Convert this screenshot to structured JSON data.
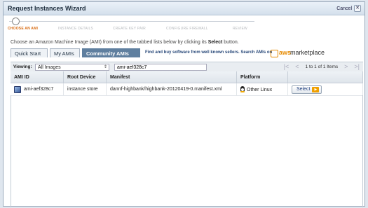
{
  "dialog": {
    "title": "Request Instances Wizard",
    "cancel_label": "Cancel"
  },
  "steps": [
    {
      "label": "CHOOSE AN AMI",
      "active": true
    },
    {
      "label": "INSTANCE DETAILS",
      "active": false
    },
    {
      "label": "CREATE KEY PAIR",
      "active": false
    },
    {
      "label": "CONFIGURE FIREWALL",
      "active": false
    },
    {
      "label": "REVIEW",
      "active": false
    }
  ],
  "intro": {
    "before": "Choose an Amazon Machine Image (AMI) from one of the tabbed lists below by clicking its ",
    "bold": "Select",
    "after": " button."
  },
  "tabs": [
    {
      "label": "Quick Start",
      "active": false
    },
    {
      "label": "My AMIs",
      "active": false
    },
    {
      "label": "Community AMIs",
      "active": true
    }
  ],
  "marketplace": {
    "note": "Find and buy software from well known sellers. Search AMIs on",
    "logo_aws": "aws",
    "logo_rest": "marketplace"
  },
  "filter": {
    "viewing_label": "Viewing:",
    "viewing_value": "All Images",
    "search_value": "ami-aef328c7",
    "pager_text": "1 to 1 of 1 Items"
  },
  "table": {
    "columns": [
      "AMI ID",
      "Root Device",
      "Manifest",
      "Platform",
      ""
    ],
    "rows": [
      {
        "ami_id": "ami-aef328c7",
        "root_device": "instance store",
        "manifest": "dannf-highbank/highbank-20120419-0.manifest.xml",
        "platform": "Other Linux",
        "action": "Select"
      }
    ]
  },
  "colors": {
    "accent": "#d86a10",
    "tab_active": "#5f7f9f",
    "marketplace": "#e68a00"
  }
}
